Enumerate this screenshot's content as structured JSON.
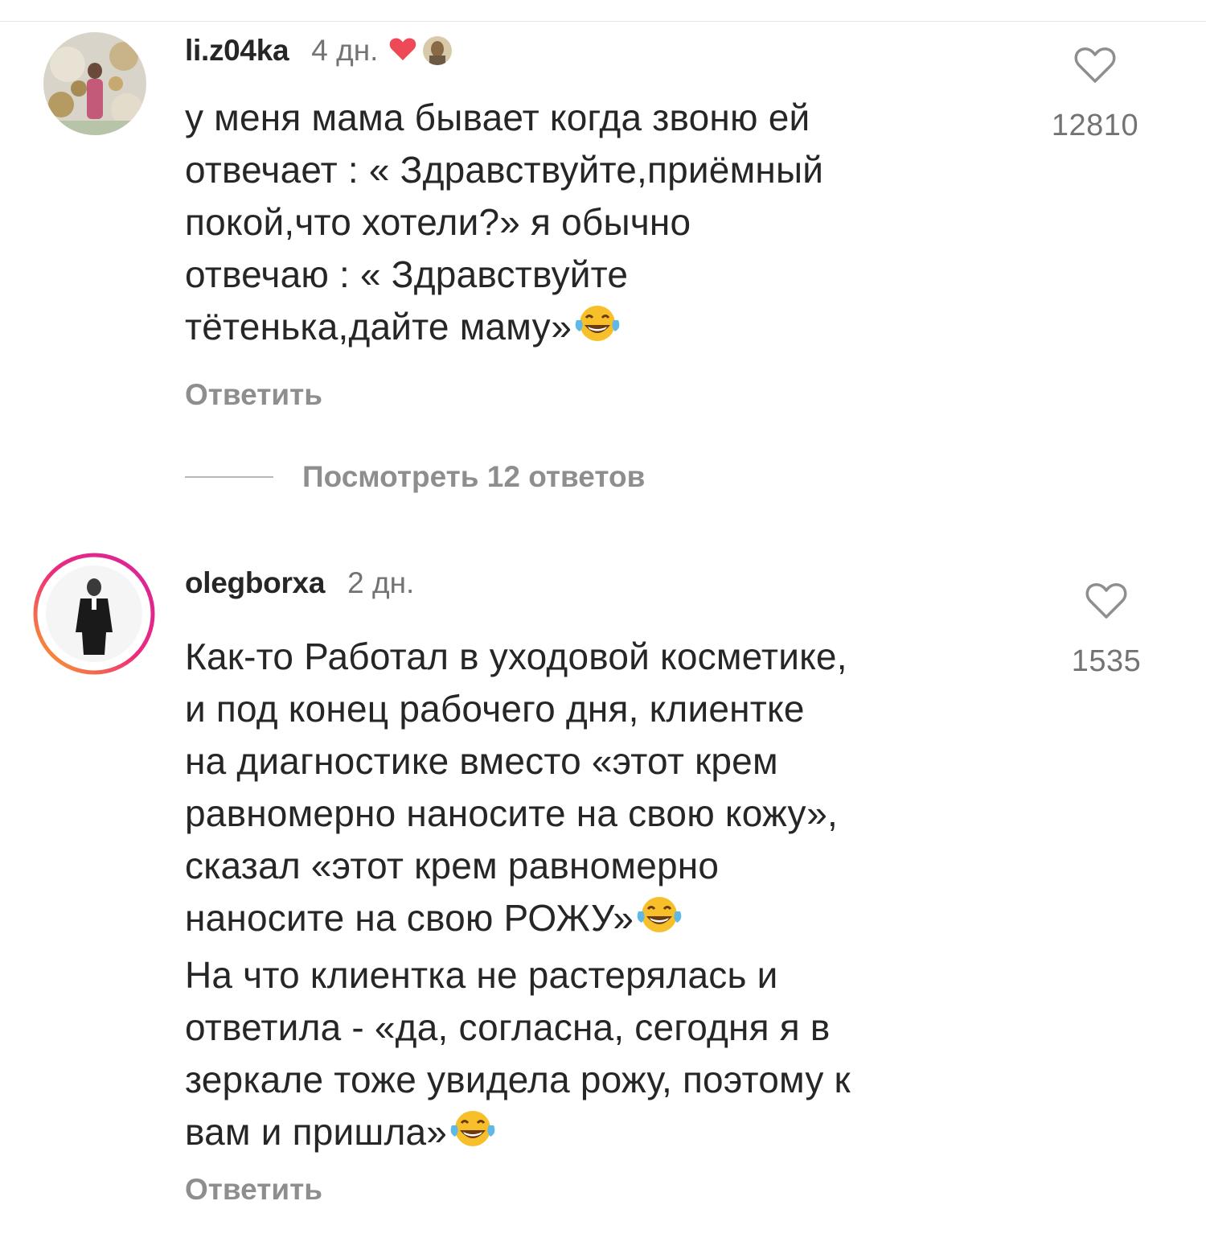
{
  "comments": [
    {
      "username": "li.z04ka",
      "time": "4 дн.",
      "text": "у меня мама бывает когда звоню ей\nотвечает : « Здравствуйте,приёмный\nпокой,что хотели?» я обычно\nотвечаю : « Здравствуйте\nтётенька,дайте маму»",
      "reply_label": "Ответить",
      "like_count": "12810",
      "view_replies_label": "Посмотреть 12 ответов",
      "icons": [
        "heart-outline-icon",
        "red-heart-icon",
        "author-avatar",
        "laughing-tears-emoji"
      ]
    },
    {
      "username": "olegborxa",
      "time": "2 дн.",
      "text": "Как-то Работал в уходовой косметике,\nи под конец рабочего дня, клиентке\nна диагностике вместо «этот крем\nравномерно наносите на свою кожу»,\nсказал «этот крем равномерно\nнаносите на свою РОЖУ»",
      "text2": "\nНа что клиентка не растерялась и\nответила - «да, согласна, сегодня я в\nзеркале тоже увидела рожу, поэтому к\nвам и пришла»",
      "reply_label": "Ответить",
      "like_count": "1535",
      "icons": [
        "heart-outline-icon",
        "laughing-tears-emoji"
      ]
    }
  ],
  "colors": {
    "text": "#262626",
    "secondary": "#737373",
    "link": "#8e8e8e",
    "heart": "#ed4956",
    "story_ring_start": "#f9a825",
    "story_ring_end": "#d6249f"
  }
}
